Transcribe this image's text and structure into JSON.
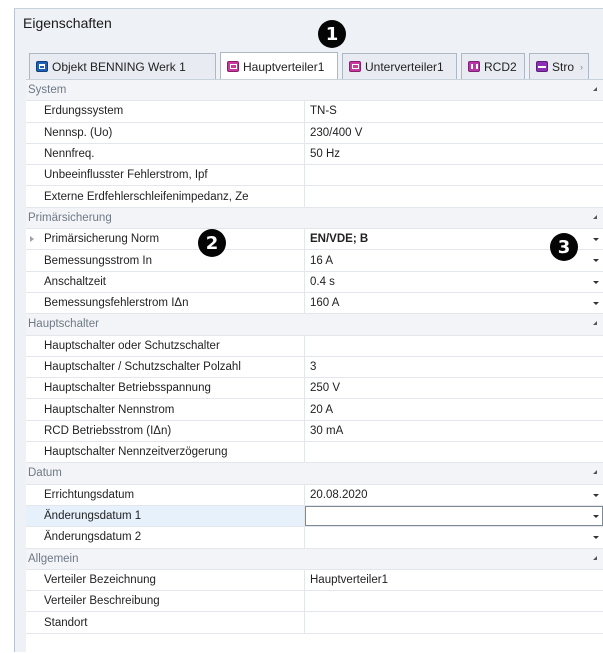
{
  "panel": {
    "title": "Eigenschaften"
  },
  "tabs": [
    {
      "label": "Objekt BENNING Werk 1",
      "icon": "building-icon"
    },
    {
      "label": "Hauptverteiler1",
      "icon": "distribution-board-icon"
    },
    {
      "label": "Unterverteiler1",
      "icon": "distribution-board-icon"
    },
    {
      "label": "RCD2",
      "icon": "rcd-icon"
    },
    {
      "label": "Stro",
      "icon": "circuit-icon"
    }
  ],
  "sections": {
    "system": {
      "title": "System",
      "rows": [
        {
          "name": "Erdungssystem",
          "value": "TN-S"
        },
        {
          "name": "Nennsp. (Uo)",
          "value": "230/400 V"
        },
        {
          "name": "Nennfreq.",
          "value": "50 Hz"
        },
        {
          "name": "Unbeeinflusster Fehlerstrom, Ipf",
          "value": ""
        },
        {
          "name": "Externe Erdfehlerschleifenimpedanz, Ze",
          "value": ""
        }
      ]
    },
    "primaer": {
      "title": "Primärsicherung",
      "rows": [
        {
          "name": "Primärsicherung Norm",
          "value": "EN/VDE; B"
        },
        {
          "name": "Bemessungsstrom In",
          "value": "16 A"
        },
        {
          "name": "Anschaltzeit",
          "value": "0.4 s"
        },
        {
          "name": "Bemessungsfehlerstrom IΔn",
          "value": "160 A"
        }
      ]
    },
    "haupt": {
      "title": "Hauptschalter",
      "rows": [
        {
          "name": "Hauptschalter oder Schutzschalter",
          "value": ""
        },
        {
          "name": "Hauptschalter / Schutzschalter Polzahl",
          "value": "3"
        },
        {
          "name": "Hauptschalter Betriebsspannung",
          "value": "250 V"
        },
        {
          "name": "Hauptschalter Nennstrom",
          "value": "20 A"
        },
        {
          "name": "RCD Betriebsstrom (IΔn)",
          "value": "30 mA"
        },
        {
          "name": "Hauptschalter Nennzeitverzögerung",
          "value": ""
        }
      ]
    },
    "datum": {
      "title": "Datum",
      "rows": [
        {
          "name": "Errichtungsdatum",
          "value": "20.08.2020"
        },
        {
          "name": "Änderungsdatum 1",
          "value": ""
        },
        {
          "name": "Änderungsdatum 2",
          "value": ""
        }
      ]
    },
    "allgemein": {
      "title": "Allgemein",
      "rows": [
        {
          "name": "Verteiler Bezeichnung",
          "value": "Hauptverteiler1"
        },
        {
          "name": "Verteiler Beschreibung",
          "value": ""
        },
        {
          "name": "Standort",
          "value": ""
        }
      ]
    }
  },
  "callouts": [
    "1",
    "2",
    "3"
  ]
}
